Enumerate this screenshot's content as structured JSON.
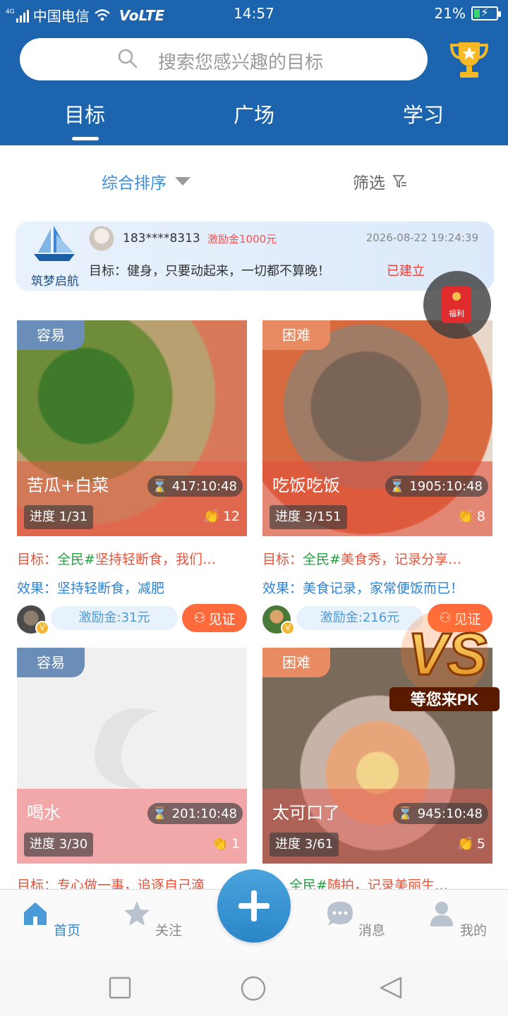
{
  "status_bar": {
    "network": "4G",
    "carrier": "中国电信",
    "volte": "VoLTE",
    "time": "14:57",
    "battery": "21%"
  },
  "search": {
    "placeholder": "搜索您感兴趣的目标"
  },
  "tabs": [
    {
      "label": "目标",
      "active": true
    },
    {
      "label": "广场"
    },
    {
      "label": "学习"
    }
  ],
  "sort": {
    "label": "综合排序",
    "filter_label": "筛选"
  },
  "banner": {
    "brand": "筑梦启航",
    "user": "183****8313",
    "reward": "激励金1000元",
    "time": "2026-08-22 19:24:39",
    "goal": "目标：健身，只要动起来，一切都不算晚！",
    "status": "已建立"
  },
  "fuli": {
    "label": "福利"
  },
  "cards": [
    {
      "difficulty": "容易",
      "title": "苦瓜+白菜",
      "timer": "417:10:48",
      "progress": "进度 1/31",
      "claps": "12",
      "goal_label": "目标：",
      "goal_tag": "全民#",
      "goal_text": "坚持轻断食，我们…",
      "effect": "效果：坚持轻断食，减肥",
      "reward": "激励金:31元",
      "witness": "见证"
    },
    {
      "difficulty": "困难",
      "title": "吃饭吃饭",
      "timer": "1905:10:48",
      "progress": "进度 3/151",
      "claps": "8",
      "goal_label": "目标：",
      "goal_tag": "全民#",
      "goal_text": "美食秀，记录分享…",
      "effect": "效果：美食记录，家常便饭而已！",
      "reward": "激励金:216元",
      "witness": "见证"
    },
    {
      "difficulty": "容易",
      "title": "喝水",
      "timer": "201:10:48",
      "progress": "进度 3/30",
      "claps": "1"
    },
    {
      "difficulty": "困难",
      "title": "太可口了",
      "timer": "945:10:48",
      "progress": "进度 3/61",
      "claps": "5"
    }
  ],
  "peek": {
    "left_label": "目标：",
    "left_text": "专心做一事，追逐自己滴",
    "right_label": "标：",
    "right_tag": "全民#",
    "right_text": "随拍，记录美丽生…"
  },
  "vs": {
    "caption": "等您来PK"
  },
  "nav": {
    "home": "首页",
    "follow": "关注",
    "messages": "消息",
    "mine": "我的"
  },
  "colors": {
    "primary": "#1c64ad",
    "accent": "#ff6b3d",
    "link": "#2f82d2"
  }
}
